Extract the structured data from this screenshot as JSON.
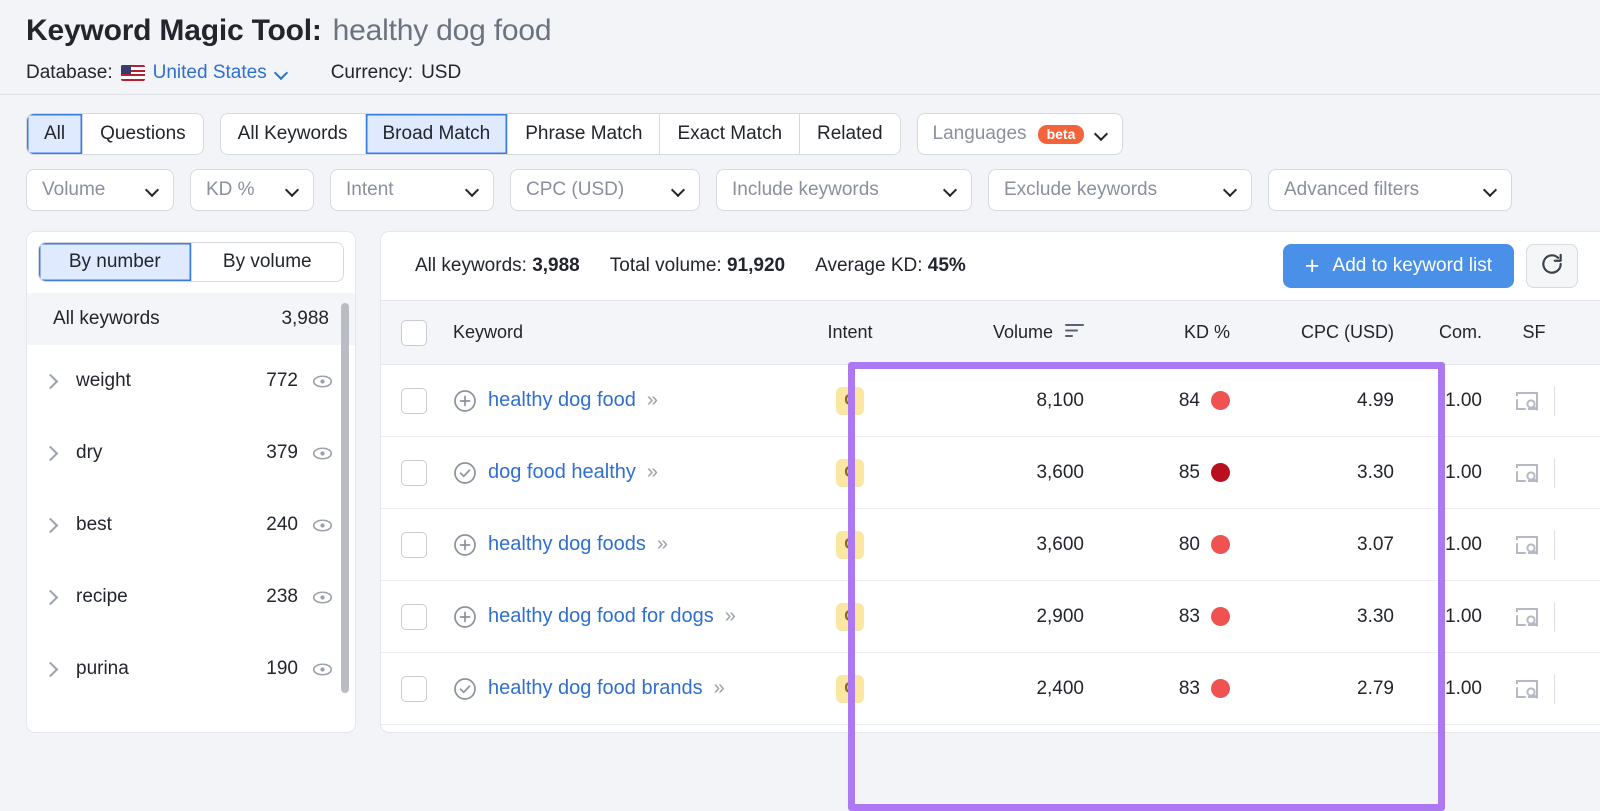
{
  "header": {
    "title_main": "Keyword Magic Tool:",
    "title_keyword": "healthy dog food",
    "database_label": "Database:",
    "database_value": "United States",
    "currency_label": "Currency:",
    "currency_value": "USD"
  },
  "filters": {
    "type_tabs": [
      {
        "label": "All",
        "active": true
      },
      {
        "label": "Questions",
        "active": false
      }
    ],
    "match_tabs": [
      {
        "label": "All Keywords",
        "active": false
      },
      {
        "label": "Broad Match",
        "active": true
      },
      {
        "label": "Phrase Match",
        "active": false
      },
      {
        "label": "Exact Match",
        "active": false
      },
      {
        "label": "Related",
        "active": false
      }
    ],
    "languages": {
      "label": "Languages",
      "badge": "beta"
    },
    "dropdowns": [
      "Volume",
      "KD %",
      "Intent",
      "CPC (USD)",
      "Include keywords",
      "Exclude keywords",
      "Advanced filters"
    ]
  },
  "sidebar": {
    "toggle": [
      {
        "label": "By number",
        "active": true
      },
      {
        "label": "By volume",
        "active": false
      }
    ],
    "all_keywords_label": "All keywords",
    "all_keywords_count": "3,988",
    "groups": [
      {
        "name": "weight",
        "count": "772"
      },
      {
        "name": "dry",
        "count": "379"
      },
      {
        "name": "best",
        "count": "240"
      },
      {
        "name": "recipe",
        "count": "238"
      },
      {
        "name": "purina",
        "count": "190"
      }
    ]
  },
  "stats": {
    "all_keywords_label": "All keywords:",
    "all_keywords_value": "3,988",
    "total_volume_label": "Total volume:",
    "total_volume_value": "91,920",
    "average_kd_label": "Average KD:",
    "average_kd_value": "45%",
    "add_button_label": "Add to keyword list",
    "add_button_plus": "+",
    "refresh_icon": "refresh-icon"
  },
  "table": {
    "columns": {
      "keyword": "Keyword",
      "intent": "Intent",
      "volume": "Volume",
      "kd": "KD %",
      "cpc": "CPC (USD)",
      "com": "Com.",
      "sf": "SF"
    },
    "rows": [
      {
        "keyword": "healthy dog food",
        "state_icon": "plus-circle-icon",
        "intent": "C",
        "volume": "8,100",
        "kd": "84",
        "kd_color": "#f05252",
        "cpc": "4.99",
        "com": "1.00",
        "sf": "serp-features-icon"
      },
      {
        "keyword": "dog food healthy",
        "state_icon": "check-circle-icon",
        "intent": "C",
        "volume": "3,600",
        "kd": "85",
        "kd_color": "#b91020",
        "cpc": "3.30",
        "com": "1.00",
        "sf": "serp-features-icon"
      },
      {
        "keyword": "healthy dog foods",
        "state_icon": "plus-circle-icon",
        "intent": "C",
        "volume": "3,600",
        "kd": "80",
        "kd_color": "#f05252",
        "cpc": "3.07",
        "com": "1.00",
        "sf": "serp-features-icon"
      },
      {
        "keyword": "healthy dog food for dogs",
        "state_icon": "plus-circle-icon",
        "intent": "C",
        "volume": "2,900",
        "kd": "83",
        "kd_color": "#f05252",
        "cpc": "3.30",
        "com": "1.00",
        "sf": "serp-features-icon"
      },
      {
        "keyword": "healthy dog food brands",
        "state_icon": "check-circle-icon",
        "intent": "C",
        "volume": "2,400",
        "kd": "83",
        "kd_color": "#f05252",
        "cpc": "2.79",
        "com": "1.00",
        "sf": "serp-features-icon"
      }
    ]
  },
  "annotation": {
    "highlight_color": "#ad79f2"
  }
}
